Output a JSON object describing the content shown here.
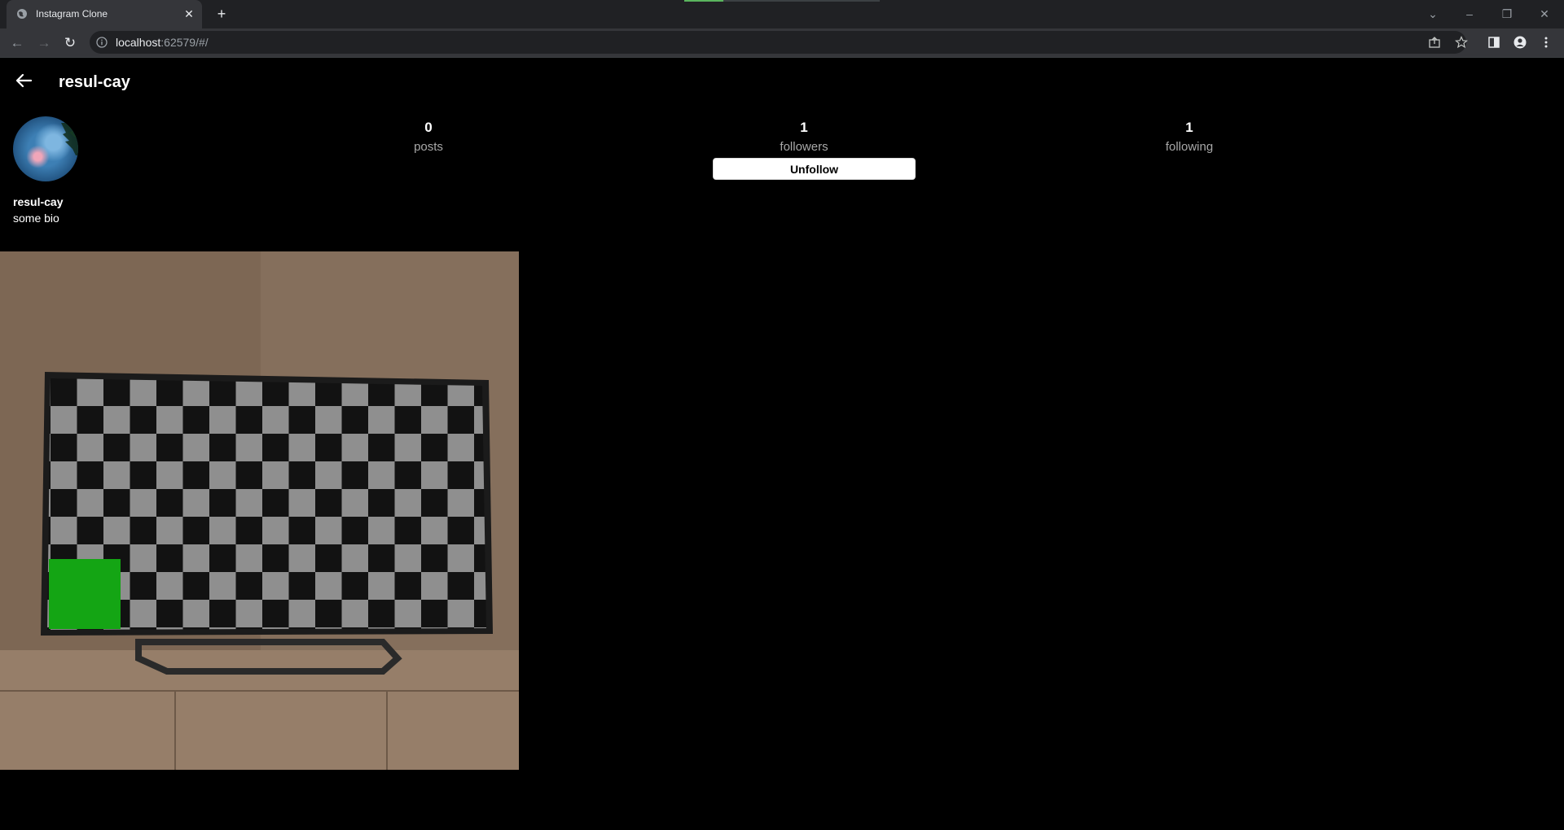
{
  "browser": {
    "tab_title": "Instagram Clone",
    "url_host": "localhost",
    "url_rest": ":62579/#/"
  },
  "profile": {
    "header_username": "resul-cay",
    "name": "resul-cay",
    "bio": "some bio",
    "stats": [
      {
        "value": "0",
        "label": "posts"
      },
      {
        "value": "1",
        "label": "followers"
      },
      {
        "value": "1",
        "label": "following"
      }
    ],
    "unfollow_label": "Unfollow"
  },
  "icons": {
    "back": "arrow-left-icon",
    "avatar": "avatar",
    "info": "info-icon"
  },
  "colors": {
    "background": "#000000",
    "chrome_dark": "#202124",
    "chrome": "#35363a",
    "text_secondary": "#a8a8a8",
    "button_bg": "#ffffff",
    "post_highlight_green": "#14a514"
  }
}
